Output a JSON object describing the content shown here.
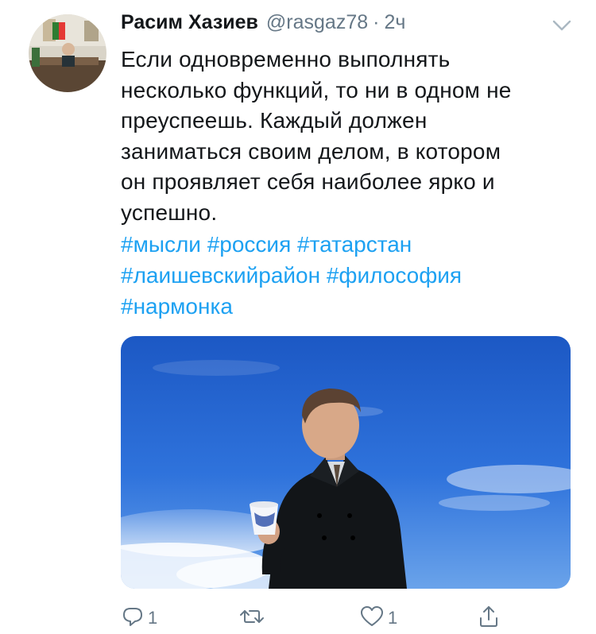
{
  "tweet": {
    "author": {
      "display_name": "Расим Хазиев",
      "handle": "@rasgaz78",
      "separator": "·",
      "time": "2ч"
    },
    "text_lines": [
      "Если одновременно выполнять",
      "несколько функций, то ни в одном не",
      "преуспеешь. Каждый должен",
      "заниматься своим делом, в котором",
      "он проявляет себя наиболее ярко и",
      "успешно."
    ],
    "hashtags": {
      "line1": [
        "#мысли",
        "#россия",
        "#татарстан"
      ],
      "line2": [
        "#лаишевскийрайон",
        "#философия"
      ],
      "line3": [
        "#нармонка"
      ]
    },
    "actions": {
      "reply_count": "1",
      "retweet_count": "",
      "like_count": "1"
    }
  },
  "colors": {
    "text": "#14171a",
    "secondary": "#657786",
    "link": "#1da1f2",
    "sky": "#2f6fd6"
  },
  "icons": [
    "avatar-photo",
    "chevron-down-icon",
    "reply-icon",
    "retweet-icon",
    "like-icon",
    "share-icon"
  ]
}
